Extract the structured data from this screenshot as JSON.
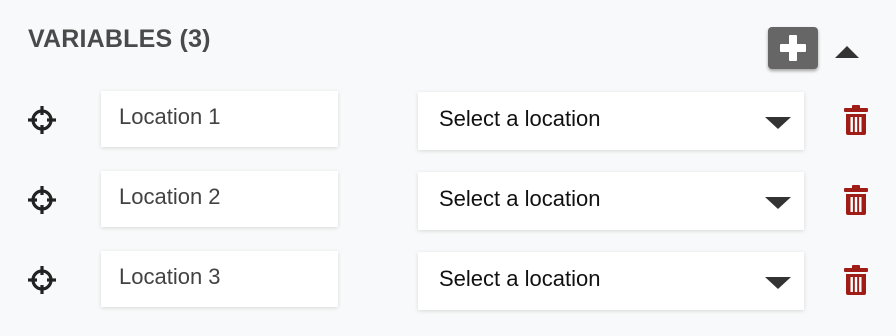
{
  "header": {
    "title": "VARIABLES (3)",
    "add_icon": "plus-icon",
    "collapse_icon": "caret-up-icon"
  },
  "variables": [
    {
      "name": "Location 1",
      "select_value": "Select a location"
    },
    {
      "name": "Location 2",
      "select_value": "Select a location"
    },
    {
      "name": "Location 3",
      "select_value": "Select a location"
    }
  ],
  "icons": {
    "drag": "crosshair-move-icon",
    "dropdown": "caret-down-icon",
    "delete": "trash-icon"
  },
  "colors": {
    "background": "#f8f9fa",
    "title": "#4a4a4a",
    "add_button": "#666666",
    "delete_icon": "#a01c17",
    "icon_dark": "#222222"
  }
}
